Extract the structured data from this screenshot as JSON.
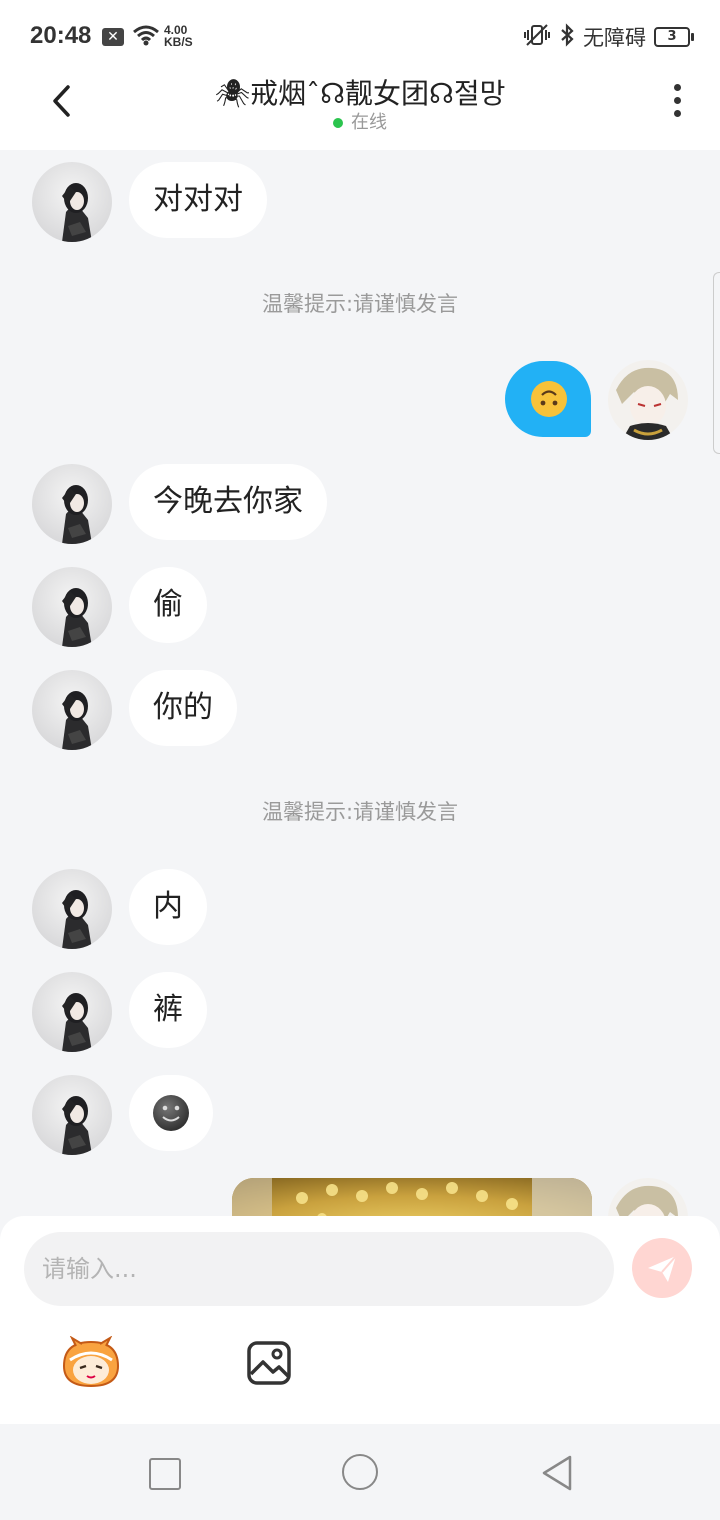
{
  "status_bar": {
    "time": "20:48",
    "speed_value": "4.00",
    "speed_unit": "KB/S",
    "accessibility": "无障碍",
    "battery": "3",
    "notification_icon": "x-box-icon"
  },
  "header": {
    "title": "🕷戒烟ˆ☊靓女团☊절망",
    "status": "在线"
  },
  "chat": {
    "messages": [
      {
        "from": "other",
        "text": "对对对"
      },
      {
        "type": "notice",
        "text": "温馨提示:请谨慎发言"
      },
      {
        "from": "me",
        "emoji": "upside-down-face"
      },
      {
        "from": "other",
        "text": "今晚去你家"
      },
      {
        "from": "other",
        "text": "偷"
      },
      {
        "from": "other",
        "text": "你的"
      },
      {
        "type": "notice",
        "text": "温馨提示:请谨慎发言"
      },
      {
        "from": "other",
        "text": "内"
      },
      {
        "from": "other",
        "text": "裤"
      },
      {
        "from": "other",
        "emoji": "dark-smiley-face"
      },
      {
        "from": "me",
        "image": "food-photo"
      }
    ]
  },
  "composer": {
    "placeholder": "请输入..."
  },
  "colors": {
    "sent_bubble": "#22b1f5",
    "online_dot": "#2bc44e",
    "send_button": "#ffd6d2"
  }
}
